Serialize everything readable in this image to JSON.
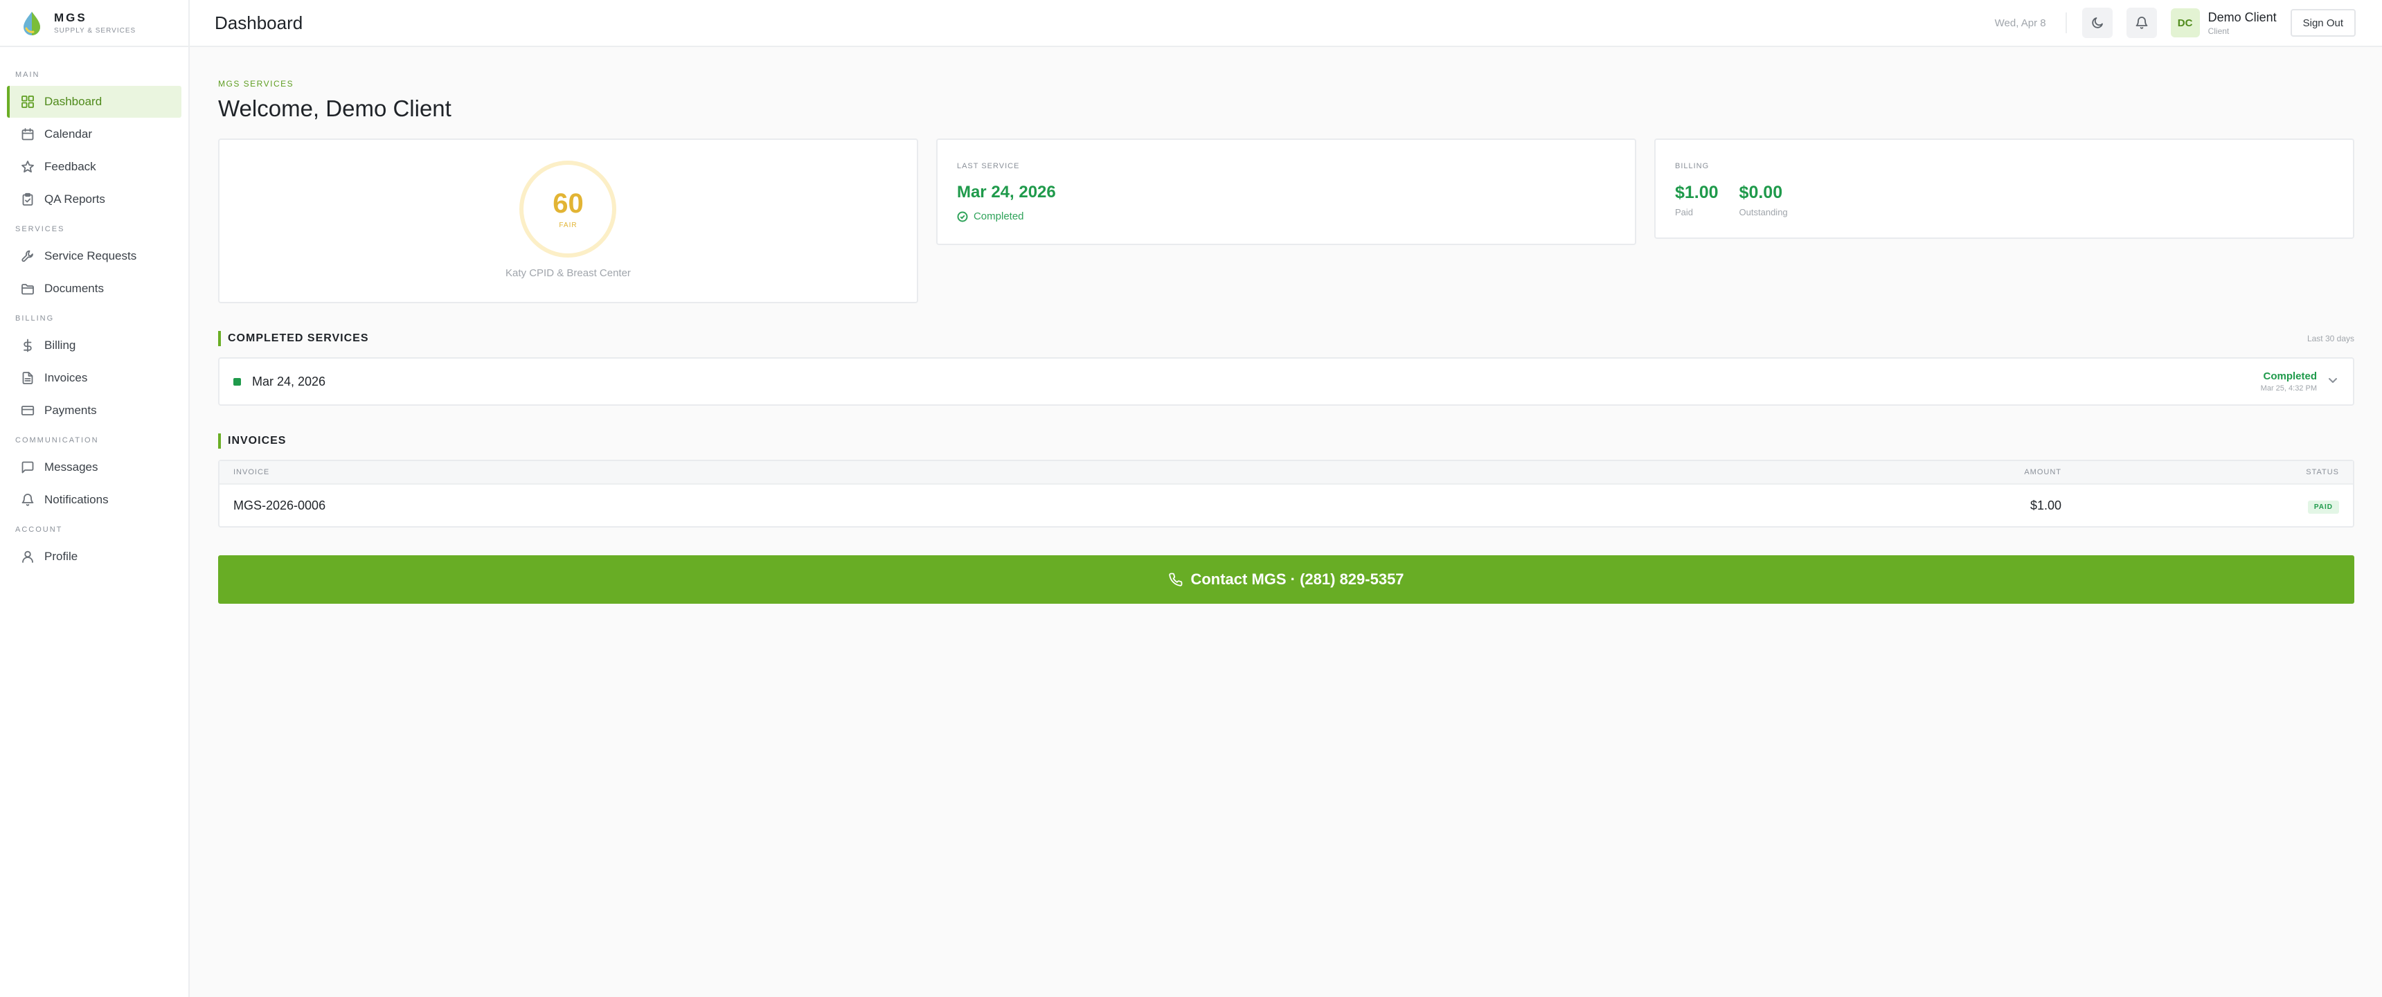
{
  "brand": {
    "name": "MGS",
    "subtitle": "SUPPLY & SERVICES"
  },
  "sidebar": {
    "sections": [
      {
        "title": "MAIN",
        "items": [
          {
            "label": "Dashboard",
            "icon": "grid-icon",
            "active": true
          },
          {
            "label": "Calendar",
            "icon": "calendar-icon"
          },
          {
            "label": "Feedback",
            "icon": "star-icon"
          },
          {
            "label": "QA Reports",
            "icon": "clipboard-icon"
          }
        ]
      },
      {
        "title": "SERVICES",
        "items": [
          {
            "label": "Service Requests",
            "icon": "wrench-icon"
          },
          {
            "label": "Documents",
            "icon": "folder-icon"
          }
        ]
      },
      {
        "title": "BILLING",
        "items": [
          {
            "label": "Billing",
            "icon": "dollar-icon"
          },
          {
            "label": "Invoices",
            "icon": "file-icon"
          },
          {
            "label": "Payments",
            "icon": "credit-card-icon"
          }
        ]
      },
      {
        "title": "COMMUNICATION",
        "items": [
          {
            "label": "Messages",
            "icon": "message-icon"
          },
          {
            "label": "Notifications",
            "icon": "bell-icon"
          }
        ]
      },
      {
        "title": "ACCOUNT",
        "items": [
          {
            "label": "Profile",
            "icon": "user-icon"
          }
        ]
      }
    ]
  },
  "topbar": {
    "title": "Dashboard",
    "date": "Wed, Apr 8",
    "avatar_initials": "DC",
    "user_name": "Demo Client",
    "user_role": "Client",
    "signout_label": "Sign Out"
  },
  "main": {
    "eyebrow": "MGS SERVICES",
    "welcome": "Welcome, Demo Client",
    "score": {
      "value": "60",
      "label": "FAIR",
      "site": "Katy CPID & Breast Center"
    },
    "last_service": {
      "label": "LAST SERVICE",
      "date": "Mar 24, 2026",
      "status": "Completed"
    },
    "billing": {
      "label": "BILLING",
      "paid_value": "$1.00",
      "paid_label": "Paid",
      "outstanding_value": "$0.00",
      "outstanding_label": "Outstanding"
    },
    "completed_services": {
      "title": "COMPLETED SERVICES",
      "note": "Last 30 days",
      "rows": [
        {
          "date": "Mar 24, 2026",
          "status": "Completed",
          "time": "Mar 25, 4:32 PM"
        }
      ]
    },
    "invoices": {
      "title": "INVOICES",
      "headers": {
        "invoice": "INVOICE",
        "amount": "AMOUNT",
        "status": "STATUS"
      },
      "rows": [
        {
          "invoice": "MGS-2026-0006",
          "amount": "$1.00",
          "status": "PAID"
        }
      ]
    },
    "contact_label": "Contact MGS · (281) 829-5357"
  },
  "colors": {
    "accent": "#68ad25",
    "success": "#1f9a4b",
    "score": "#e2b434"
  }
}
